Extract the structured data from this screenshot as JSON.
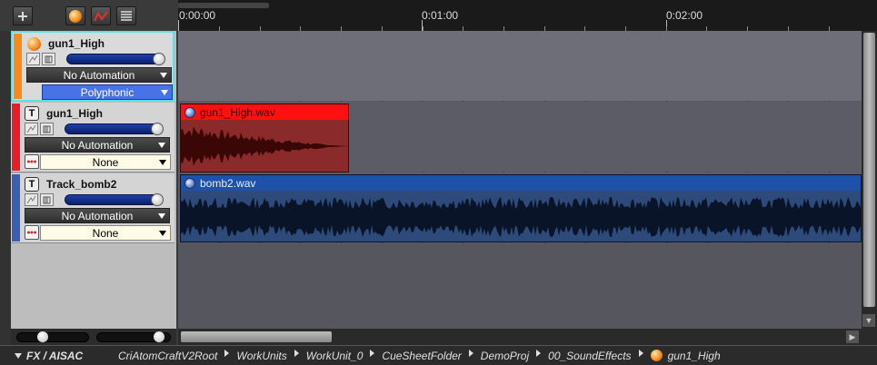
{
  "toolbar": {
    "add_icon": "plus-icon",
    "cue_icon": "orange-orb-icon",
    "automation_icon": "automation-curve-icon",
    "list_icon": "list-icon"
  },
  "tracks": [
    {
      "name": "gun1_High",
      "color": "#f58a1e",
      "icon": "orange-orb-icon",
      "automation": "No Automation",
      "mode": "Polyphonic",
      "selected": true
    },
    {
      "name": "gun1_High",
      "color": "#e81c2a",
      "icon": "text-T-icon",
      "automation": "No Automation",
      "mode": "None",
      "selected": false
    },
    {
      "name": "Track_bomb2",
      "color": "#3a5fb0",
      "icon": "text-T-icon",
      "automation": "No Automation",
      "mode": "None",
      "selected": false
    }
  ],
  "ruler": {
    "labels": [
      "0:00:00",
      "0:01:00",
      "0:02:00"
    ]
  },
  "clips": [
    {
      "name": "gun1_High.wav",
      "head_color": "#ff1010",
      "body_color": "#8a2a2a",
      "wave_color": "#3a0606"
    },
    {
      "name": "bomb2.wav",
      "head_color": "#1e52a8",
      "body_color": "#2d4a7a",
      "wave_color": "#0a1428"
    }
  ],
  "statusbar": {
    "panel": "FX / AISAC",
    "breadcrumb": [
      "CriAtomCraftV2Root",
      "WorkUnits",
      "WorkUnit_0",
      "CueSheetFolder",
      "DemoProj",
      "00_SoundEffects",
      "gun1_High"
    ]
  }
}
